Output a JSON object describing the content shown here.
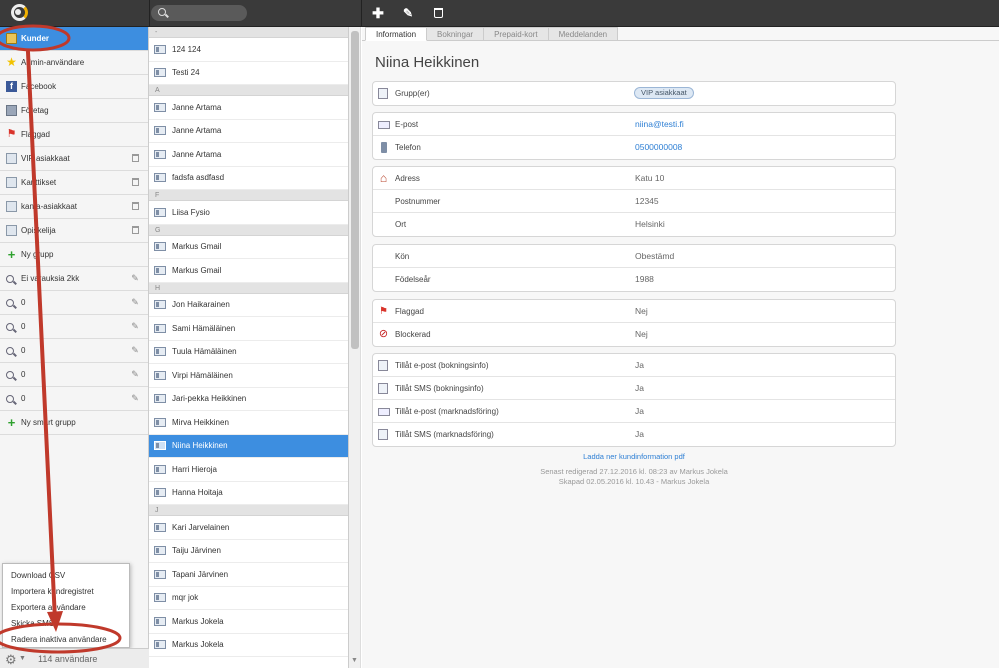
{
  "sidebar": {
    "items": [
      {
        "label": "Kunder",
        "icon": "address-book-icon",
        "active": true
      },
      {
        "label": "Admin-användare",
        "icon": "star-icon"
      },
      {
        "label": "Facebook",
        "icon": "facebook-icon"
      },
      {
        "label": "Företag",
        "icon": "building-icon"
      },
      {
        "label": "Flaggad",
        "icon": "flag-icon"
      },
      {
        "label": "VIP asiakkaat",
        "icon": "group-card-icon",
        "action": "trash-icon"
      },
      {
        "label": "Kanttikset",
        "icon": "group-card-icon",
        "action": "trash-icon"
      },
      {
        "label": "kanta-asiakkaat",
        "icon": "group-card-icon",
        "action": "trash-icon"
      },
      {
        "label": "Opiskelija",
        "icon": "group-card-icon",
        "action": "trash-icon"
      },
      {
        "label": "Ny grupp",
        "icon": "plus-icon"
      },
      {
        "label": "Ei varauksia 2kk",
        "icon": "magnifier-icon",
        "action": "pencil-icon"
      },
      {
        "label": "0",
        "icon": "magnifier-icon",
        "action": "pencil-icon"
      },
      {
        "label": "0",
        "icon": "magnifier-icon",
        "action": "pencil-icon"
      },
      {
        "label": "0",
        "icon": "magnifier-icon",
        "action": "pencil-icon"
      },
      {
        "label": "0",
        "icon": "magnifier-icon",
        "action": "pencil-icon"
      },
      {
        "label": "0",
        "icon": "magnifier-icon",
        "action": "pencil-icon"
      },
      {
        "label": "Ny smart grupp",
        "icon": "plus-icon"
      }
    ],
    "menu": [
      "Download CSV",
      "Importera kundregistret",
      "Exportera användare",
      "Skicka SMS",
      "Radera inaktiva användare"
    ],
    "footer": {
      "user_count": "114 användare"
    }
  },
  "list": [
    {
      "header": "-"
    },
    {
      "name": "124 124"
    },
    {
      "name": "Testi 24"
    },
    {
      "header": "A"
    },
    {
      "name": "Janne Artama"
    },
    {
      "name": "Janne Artama"
    },
    {
      "name": "Janne Artama"
    },
    {
      "name": "fadsfa asdfasd"
    },
    {
      "header": "F"
    },
    {
      "name": "Liisa Fysio"
    },
    {
      "header": "G"
    },
    {
      "name": "Markus Gmail"
    },
    {
      "name": "Markus Gmail"
    },
    {
      "header": "H"
    },
    {
      "name": "Jon Haikarainen"
    },
    {
      "name": "Sami Hämäläinen"
    },
    {
      "name": "Tuula Hämäläinen"
    },
    {
      "name": "Virpi Hämäläinen"
    },
    {
      "name": "Jari-pekka Heikkinen"
    },
    {
      "name": "Mirva Heikkinen"
    },
    {
      "name": "Niina Heikkinen",
      "selected": true
    },
    {
      "name": "Harri Hieroja"
    },
    {
      "name": "Hanna Hoitaja"
    },
    {
      "header": "J"
    },
    {
      "name": "Kari Jarvelainen"
    },
    {
      "name": "Taiju Järvinen"
    },
    {
      "name": "Tapani Järvinen"
    },
    {
      "name": "mqr jok"
    },
    {
      "name": "Markus Jokela"
    },
    {
      "name": "Markus Jokela"
    }
  ],
  "tabs": [
    "Information",
    "Bokningar",
    "Prepaid-kort",
    "Meddelanden"
  ],
  "detail": {
    "name": "Niina Heikkinen",
    "group_label": "Grupp(er)",
    "group_badge": "VIP asiakkaat",
    "email_label": "E-post",
    "email": "niina@testi.fi",
    "phone_label": "Telefon",
    "phone": "0500000008",
    "address_label": "Adress",
    "address": "Katu 10",
    "postcode_label": "Postnummer",
    "postcode": "12345",
    "city_label": "Ort",
    "city": "Helsinki",
    "gender_label": "Kön",
    "gender": "Obestämd",
    "birthyear_label": "Födelseår",
    "birthyear": "1988",
    "flagged_label": "Flaggad",
    "flagged": "Nej",
    "blocked_label": "Blockerad",
    "blocked": "Nej",
    "allow_email_booking_label": "Tillåt e-post (bokningsinfo)",
    "allow_email_booking": "Ja",
    "allow_sms_booking_label": "Tillåt SMS (bokningsinfo)",
    "allow_sms_booking": "Ja",
    "allow_email_marketing_label": "Tillåt e-post (marknadsföring)",
    "allow_email_marketing": "Ja",
    "allow_sms_marketing_label": "Tillåt SMS (marknadsföring)",
    "allow_sms_marketing": "Ja",
    "pdf_link": "Ladda ner kundinformation pdf",
    "last_edited": "Senast redigerad 27.12.2016 kl. 08:23 av Markus Jokela",
    "created": "Skapad 02.05.2016 kl. 10.43 - Markus Jokela"
  },
  "colors": {
    "accent": "#3d8ee0",
    "annotation": "#c0392b",
    "topbar": "#3a3a3a"
  }
}
